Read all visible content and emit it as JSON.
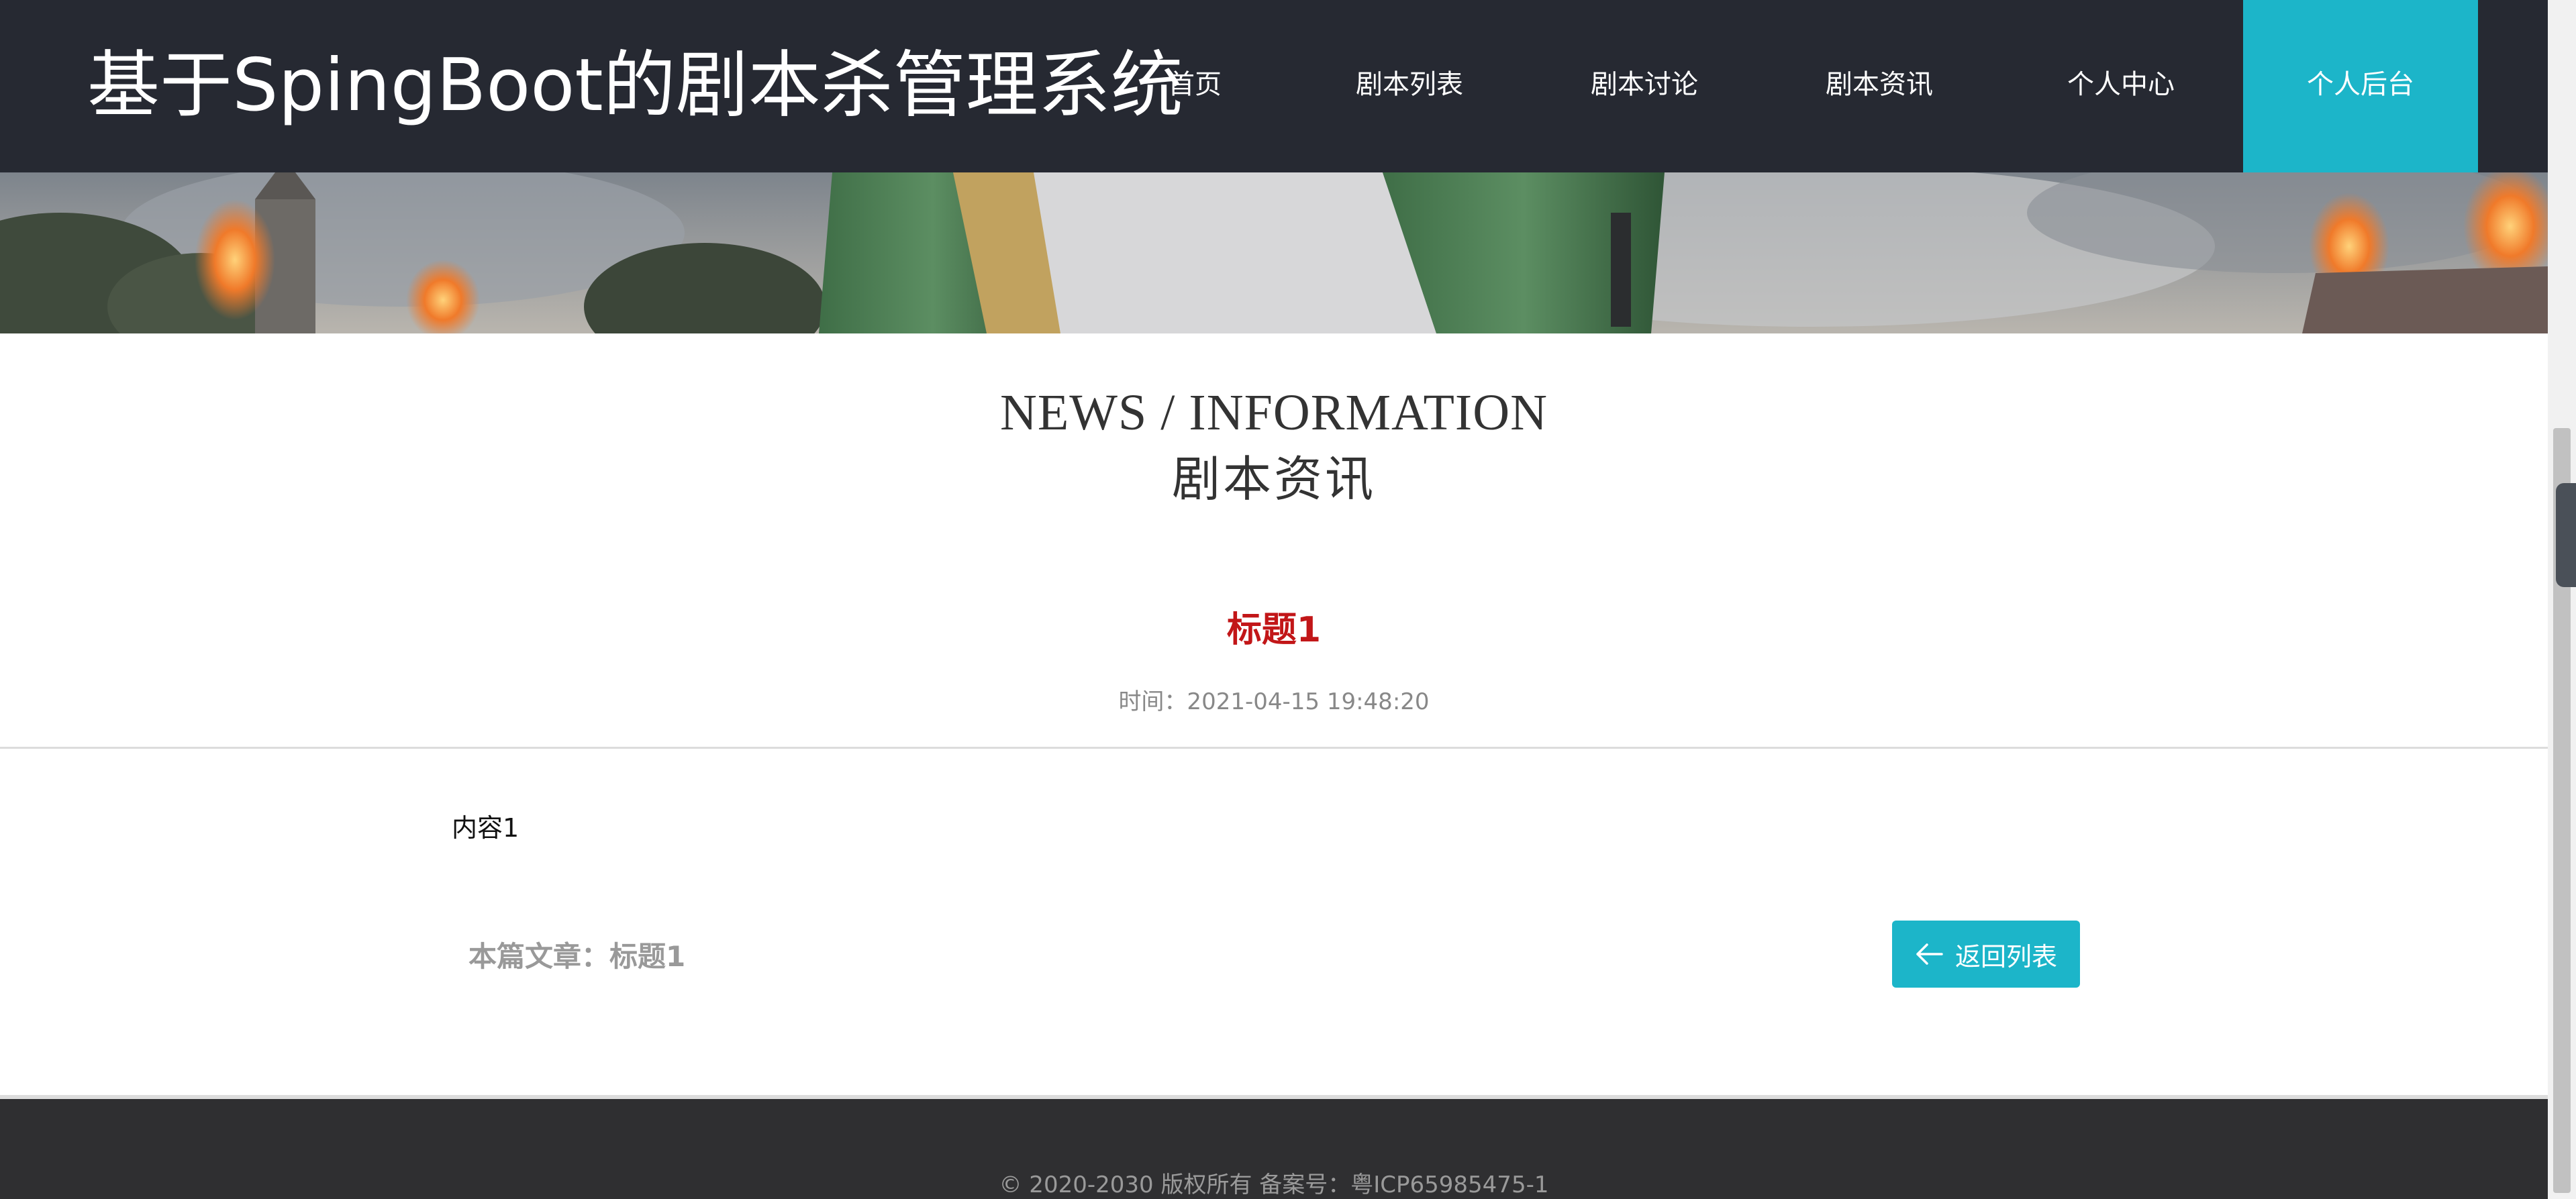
{
  "header": {
    "site_title": "基于SpingBoot的剧本杀管理系统",
    "nav": [
      {
        "label": "首页"
      },
      {
        "label": "剧本列表"
      },
      {
        "label": "剧本讨论"
      },
      {
        "label": "剧本资讯"
      },
      {
        "label": "个人中心"
      },
      {
        "label": "个人后台"
      }
    ],
    "active_nav": "个人后台"
  },
  "section": {
    "title_en": "NEWS / INFORMATION",
    "title_cn": "剧本资讯"
  },
  "article": {
    "title": "标题1",
    "time": "时间：2021-04-15 19:48:20",
    "content": "内容1",
    "this_article": "本篇文章：标题1",
    "back_label": "返回列表"
  },
  "footer": {
    "copyright": "© 2020-2030 版权所有 备案号：粤ICP65985475-1"
  },
  "colors": {
    "accent": "#1cb5c9",
    "header_bg": "#262932",
    "title_red": "#c21618",
    "footer_bg": "#2f2f31"
  }
}
